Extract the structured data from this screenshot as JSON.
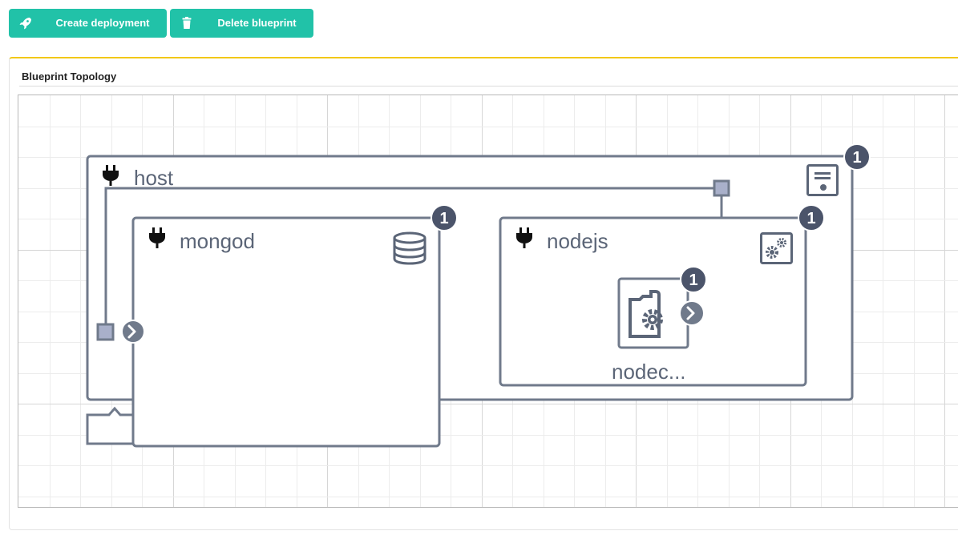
{
  "toolbar": {
    "create_label": "Create deployment",
    "create_icon": "rocket-icon",
    "delete_label": "Delete blueprint",
    "delete_icon": "trash-icon",
    "button_color": "#21c2a8"
  },
  "widget": {
    "title": "Blueprint Topology",
    "accent_color": "#f2c811"
  },
  "topology": {
    "nodes": {
      "host": {
        "name": "host",
        "instances": "1",
        "type_icon": "server-icon"
      },
      "mongod": {
        "name": "mongod",
        "instances": "1",
        "type_icon": "database-icon"
      },
      "nodejs": {
        "name": "nodejs",
        "instances": "1",
        "type_icon": "gears-icon"
      },
      "nodecellar": {
        "name": "nodec...",
        "instances": "1",
        "type_icon": "gear-folder-icon"
      }
    },
    "node_icon": "plug-icon",
    "stroke_color": "#707a8b",
    "badge_color": "#4b546a"
  }
}
